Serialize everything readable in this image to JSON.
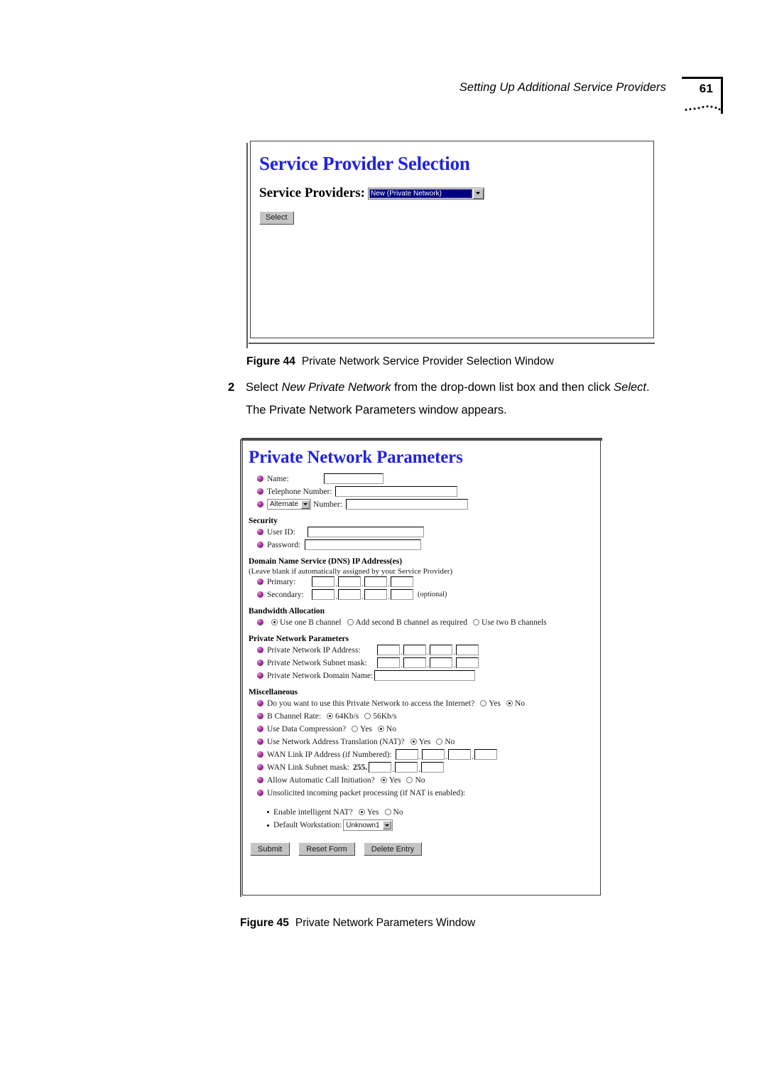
{
  "header": {
    "title": "Setting Up Additional Service Providers",
    "page_number": "61"
  },
  "figure44": {
    "caption_lead": "Figure 44",
    "caption_text": "Private Network Service Provider Selection Window",
    "window": {
      "heading": "Service Provider Selection",
      "field_label": "Service Providers:",
      "dropdown_value": "New (Private Network)",
      "select_button": "Select"
    }
  },
  "step": {
    "number": "2",
    "text_a": "Select ",
    "emphasis_a": "New Private Network",
    "text_b": " from the drop-down list box and then click ",
    "emphasis_b": "Select",
    "text_c": ".",
    "continuation": "The Private Network Parameters window appears."
  },
  "figure45": {
    "caption_lead": "Figure 45",
    "caption_text": "Private Network Parameters Window",
    "window": {
      "heading": "Private Network Parameters",
      "top_fields": [
        {
          "label": "Name:",
          "value": ""
        },
        {
          "label": "Telephone Number:",
          "value": ""
        }
      ],
      "alternate_row": {
        "select_value": "Alternate",
        "label": "Number:",
        "value": ""
      },
      "security": {
        "heading": "Security",
        "fields": [
          {
            "label": "User ID:",
            "value": ""
          },
          {
            "label": "Password:",
            "value": ""
          }
        ]
      },
      "dns": {
        "heading": "Domain Name Service (DNS) IP Address(es)",
        "note": "(Leave blank if automatically assigned by your Service Provider)",
        "primary_label": "Primary:",
        "secondary_label": "Secondary:",
        "secondary_note": "(optional)",
        "octets": [
          "",
          "",
          "",
          ""
        ]
      },
      "bandwidth": {
        "heading": "Bandwidth Allocation",
        "options": [
          {
            "label": "Use one B channel",
            "selected": true
          },
          {
            "label": "Add second B channel as required",
            "selected": false
          },
          {
            "label": "Use two B channels",
            "selected": false
          }
        ]
      },
      "private_params": {
        "heading": "Private Network Parameters",
        "ip_label": "Private Network IP Address:",
        "mask_label": "Private Network Subnet mask:",
        "domain_label": "Private Network Domain Name:",
        "domain_value": ""
      },
      "misc": {
        "heading": "Miscellaneous",
        "internet_access": {
          "label": "Do you want to use this Private Network to access the Internet?",
          "yes": "Yes",
          "no": "No",
          "selected": "No"
        },
        "b_channel_rate": {
          "label": "B Channel Rate:",
          "option1": "64Kb/s",
          "option2": "56Kb/s",
          "selected": "64Kb/s"
        },
        "data_compression": {
          "label": "Use Data Compression?",
          "yes": "Yes",
          "no": "No",
          "selected": "No"
        },
        "nat": {
          "label": "Use Network Address Translation (NAT)?",
          "yes": "Yes",
          "no": "No",
          "selected": "Yes"
        },
        "wan_ip_label": "WAN Link IP Address (if Numbered):",
        "wan_mask_label": "WAN Link Subnet mask:",
        "wan_mask_prefix": "255.",
        "auto_call": {
          "label": "Allow Automatic Call Initiation?",
          "yes": "Yes",
          "no": "No",
          "selected": "Yes"
        },
        "unsolicited_label": "Unsolicited incoming packet processing (if NAT is enabled):",
        "intelligent_nat": {
          "label": "Enable intelligent NAT?",
          "yes": "Yes",
          "no": "No",
          "selected": "Yes"
        },
        "default_workstation": {
          "label": "Default Workstation:",
          "value": "Unknown1"
        }
      },
      "buttons": {
        "submit": "Submit",
        "reset": "Reset Form",
        "delete": "Delete Entry"
      }
    }
  },
  "colors": {
    "heading_blue": "#2222dd",
    "select_navy": "#000080",
    "bullet_purple": "#b13ca6"
  }
}
